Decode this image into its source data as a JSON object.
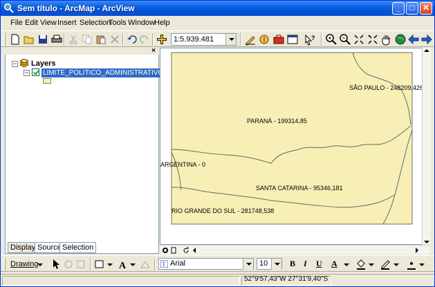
{
  "window": {
    "title": "Sem título - ArcMap - ArcView",
    "min_label": "_",
    "max_label": "□",
    "close_label": "✕"
  },
  "menu": [
    "File",
    "Edit",
    "View",
    "Insert",
    "Selection",
    "Tools",
    "Window",
    "Help"
  ],
  "standard_toolbar": {
    "scale_value": "1:5.939.481",
    "icons": [
      "new-document-icon",
      "open-icon",
      "save-icon",
      "print-icon",
      "cut-icon",
      "copy-icon",
      "paste-icon",
      "delete-icon",
      "undo-icon",
      "redo-icon",
      "add-data-icon",
      "editor-icon",
      "catalog-icon",
      "toolbox-icon",
      "window-icon",
      "whats-this-icon",
      "zoom-in-icon",
      "zoom-out-icon",
      "fixed-zoom-in-icon",
      "fixed-zoom-out-icon",
      "pan-icon",
      "full-extent-icon",
      "back-extent-icon",
      "forward-extent-icon"
    ]
  },
  "toc": {
    "root_label": "Layers",
    "layer_label": "LIMITE_POLITICO_ADMINISTRATIVO",
    "tabs": [
      "Display",
      "Source",
      "Selection"
    ],
    "close_label": "×"
  },
  "map": {
    "fill_color": "#f7efb5",
    "border_color": "#6b6b6b",
    "labels": {
      "sao_paulo": "SÃO PAULO - 248209,426",
      "parana": "PARANÁ - 199314,85",
      "argentina": "ARGENTINA - 0",
      "santa_catarina": "SANTA CATARINA - 95346,181",
      "rio_grande_do_sul": "RIO GRANDE DO SUL - 281748,538"
    }
  },
  "drawing_toolbar": {
    "drawing_label": "Drawing",
    "font_name": "Arial",
    "font_size": "10",
    "bold_label": "B",
    "italic_label": "I",
    "underline_label": "U",
    "text_color_label": "A"
  },
  "status": {
    "coordinates": "52°9'57,43\"W  27°31'9,40\"S"
  }
}
